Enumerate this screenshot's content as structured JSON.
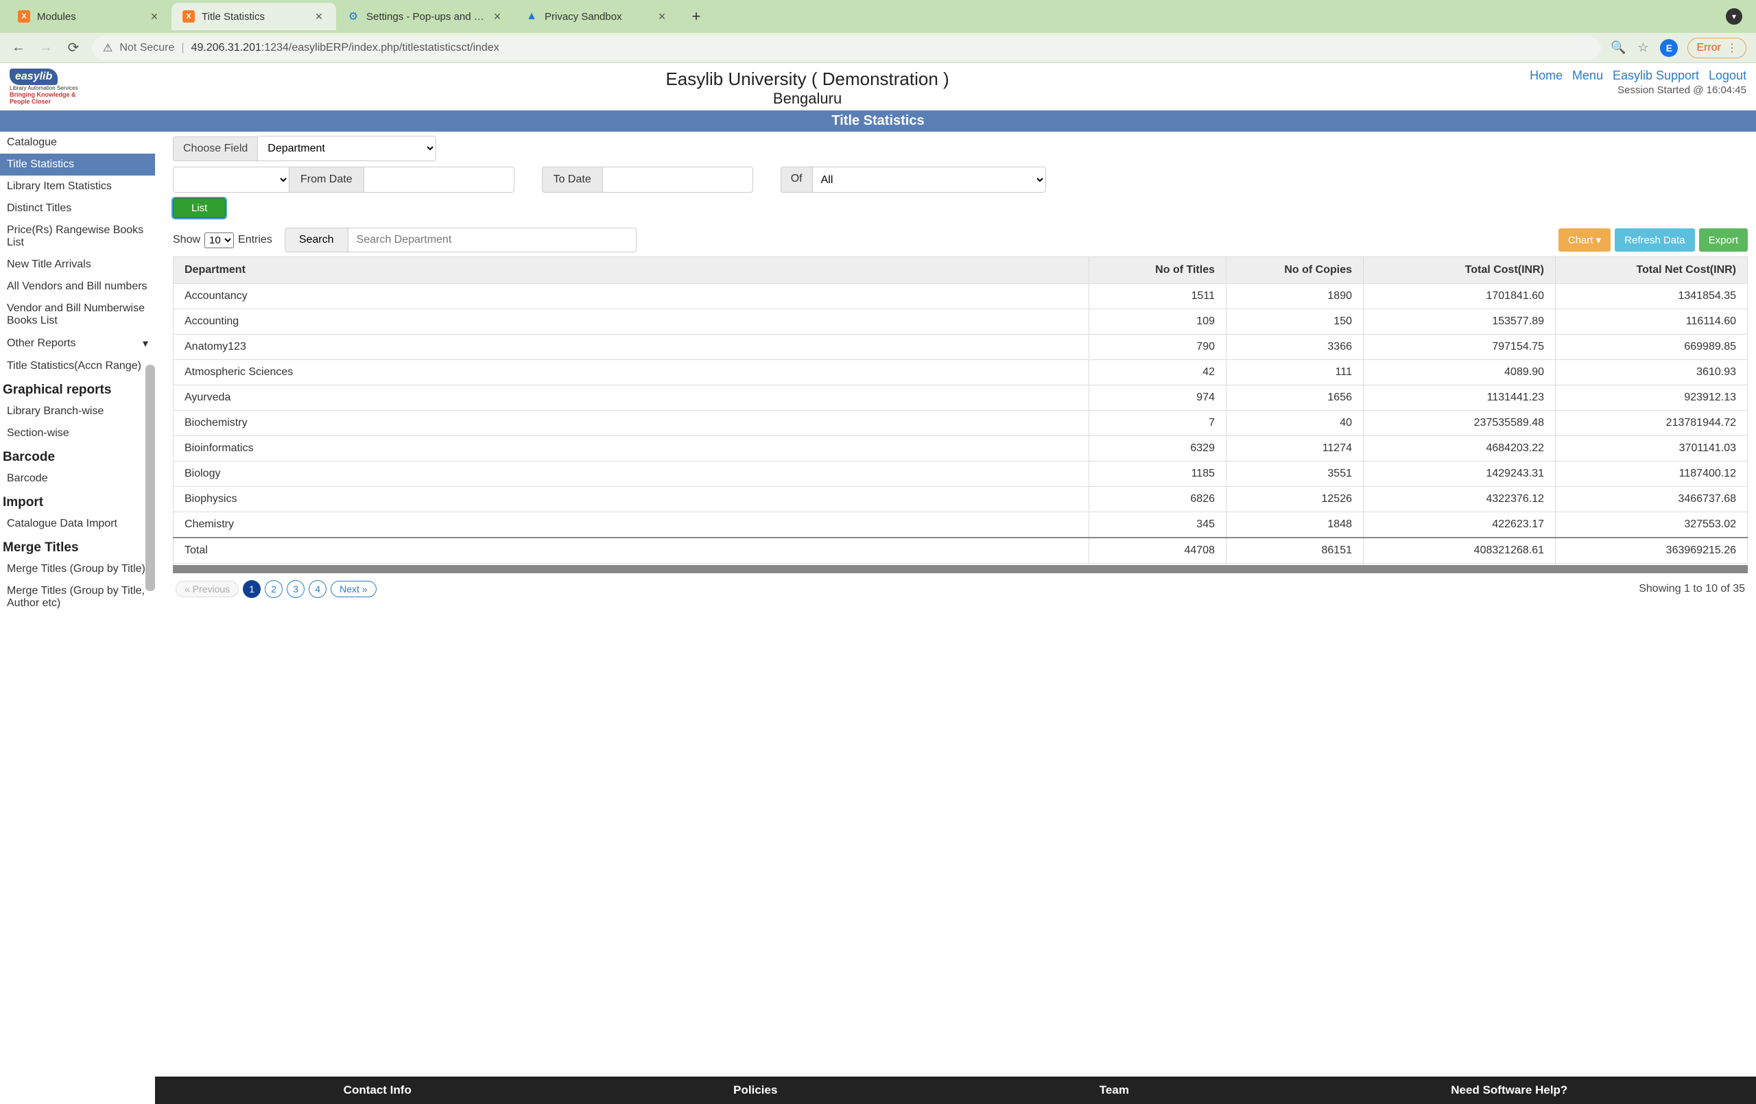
{
  "browser": {
    "tabs": [
      {
        "title": "Modules",
        "icon": "xampp"
      },
      {
        "title": "Title Statistics",
        "icon": "xampp",
        "active": true
      },
      {
        "title": "Settings - Pop-ups and redirec",
        "icon": "gear"
      },
      {
        "title": "Privacy Sandbox",
        "icon": "flask"
      }
    ],
    "not_secure": "Not Secure",
    "url_host": "49.206.31.201",
    "url_path": ":1234/easylibERP/index.php/titlestatisticsct/index",
    "profile_letter": "E",
    "error_label": "Error"
  },
  "header": {
    "logo_main": "easylib",
    "logo_sub": "Library Automation Services",
    "logo_slogan": "Bringing Knowledge & People Closer",
    "title": "Easylib University ( Demonstration )",
    "subtitle": "Bengaluru",
    "nav": {
      "home": "Home",
      "menu": "Menu",
      "support": "Easylib Support",
      "logout": "Logout"
    },
    "session": "Session Started @ 16:04:45"
  },
  "banner": "Title Statistics",
  "sidebar": {
    "items1": [
      "Catalogue",
      "Title Statistics",
      "Library Item Statistics",
      "Distinct Titles",
      "Price(Rs) Rangewise Books List",
      "New Title Arrivals",
      "All Vendors and Bill numbers",
      "Vendor and Bill Numberwise Books List",
      "Other Reports",
      "Title Statistics(Accn Range)"
    ],
    "h1": "Graphical reports",
    "items2": [
      "Library Branch-wise",
      "Section-wise"
    ],
    "h2": "Barcode",
    "items3": [
      "Barcode"
    ],
    "h3": "Import",
    "items4": [
      "Catalogue Data Import"
    ],
    "h4": "Merge Titles",
    "items5": [
      "Merge Titles (Group by Title)",
      "Merge Titles (Group by Title, Author etc)"
    ]
  },
  "filters": {
    "choose_field": "Choose Field",
    "field_value": "Department",
    "from_date": "From Date",
    "to_date": "To Date",
    "of": "Of",
    "of_value": "All",
    "list_btn": "List"
  },
  "controls": {
    "show": "Show",
    "entries": "Entries",
    "entries_value": "10",
    "search": "Search",
    "search_placeholder": "Search Department",
    "chart": "Chart",
    "refresh": "Refresh Data",
    "export": "Export"
  },
  "table": {
    "headers": [
      "Department",
      "No of Titles",
      "No of Copies",
      "Total Cost(INR)",
      "Total Net Cost(INR)"
    ],
    "rows": [
      [
        "Accountancy",
        "1511",
        "1890",
        "1701841.60",
        "1341854.35"
      ],
      [
        "Accounting",
        "109",
        "150",
        "153577.89",
        "116114.60"
      ],
      [
        "Anatomy123",
        "790",
        "3366",
        "797154.75",
        "669989.85"
      ],
      [
        "Atmospheric Sciences",
        "42",
        "111",
        "4089.90",
        "3610.93"
      ],
      [
        "Ayurveda",
        "974",
        "1656",
        "1131441.23",
        "923912.13"
      ],
      [
        "Biochemistry",
        "7",
        "40",
        "237535589.48",
        "213781944.72"
      ],
      [
        "Bioinformatics",
        "6329",
        "11274",
        "4684203.22",
        "3701141.03"
      ],
      [
        "Biology",
        "1185",
        "3551",
        "1429243.31",
        "1187400.12"
      ],
      [
        "Biophysics",
        "6826",
        "12526",
        "4322376.12",
        "3466737.68"
      ],
      [
        "Chemistry",
        "345",
        "1848",
        "422623.17",
        "327553.02"
      ]
    ],
    "total_label": "Total",
    "totals": [
      "44708",
      "86151",
      "408321268.61",
      "363969215.26"
    ]
  },
  "pager": {
    "prev": "« Previous",
    "pages": [
      "1",
      "2",
      "3",
      "4"
    ],
    "next": "Next »",
    "showing": "Showing 1 to 10 of 35"
  },
  "footer": {
    "c1": "Contact Info",
    "c2": "Policies",
    "c3": "Team",
    "c4": "Need Software Help?"
  }
}
